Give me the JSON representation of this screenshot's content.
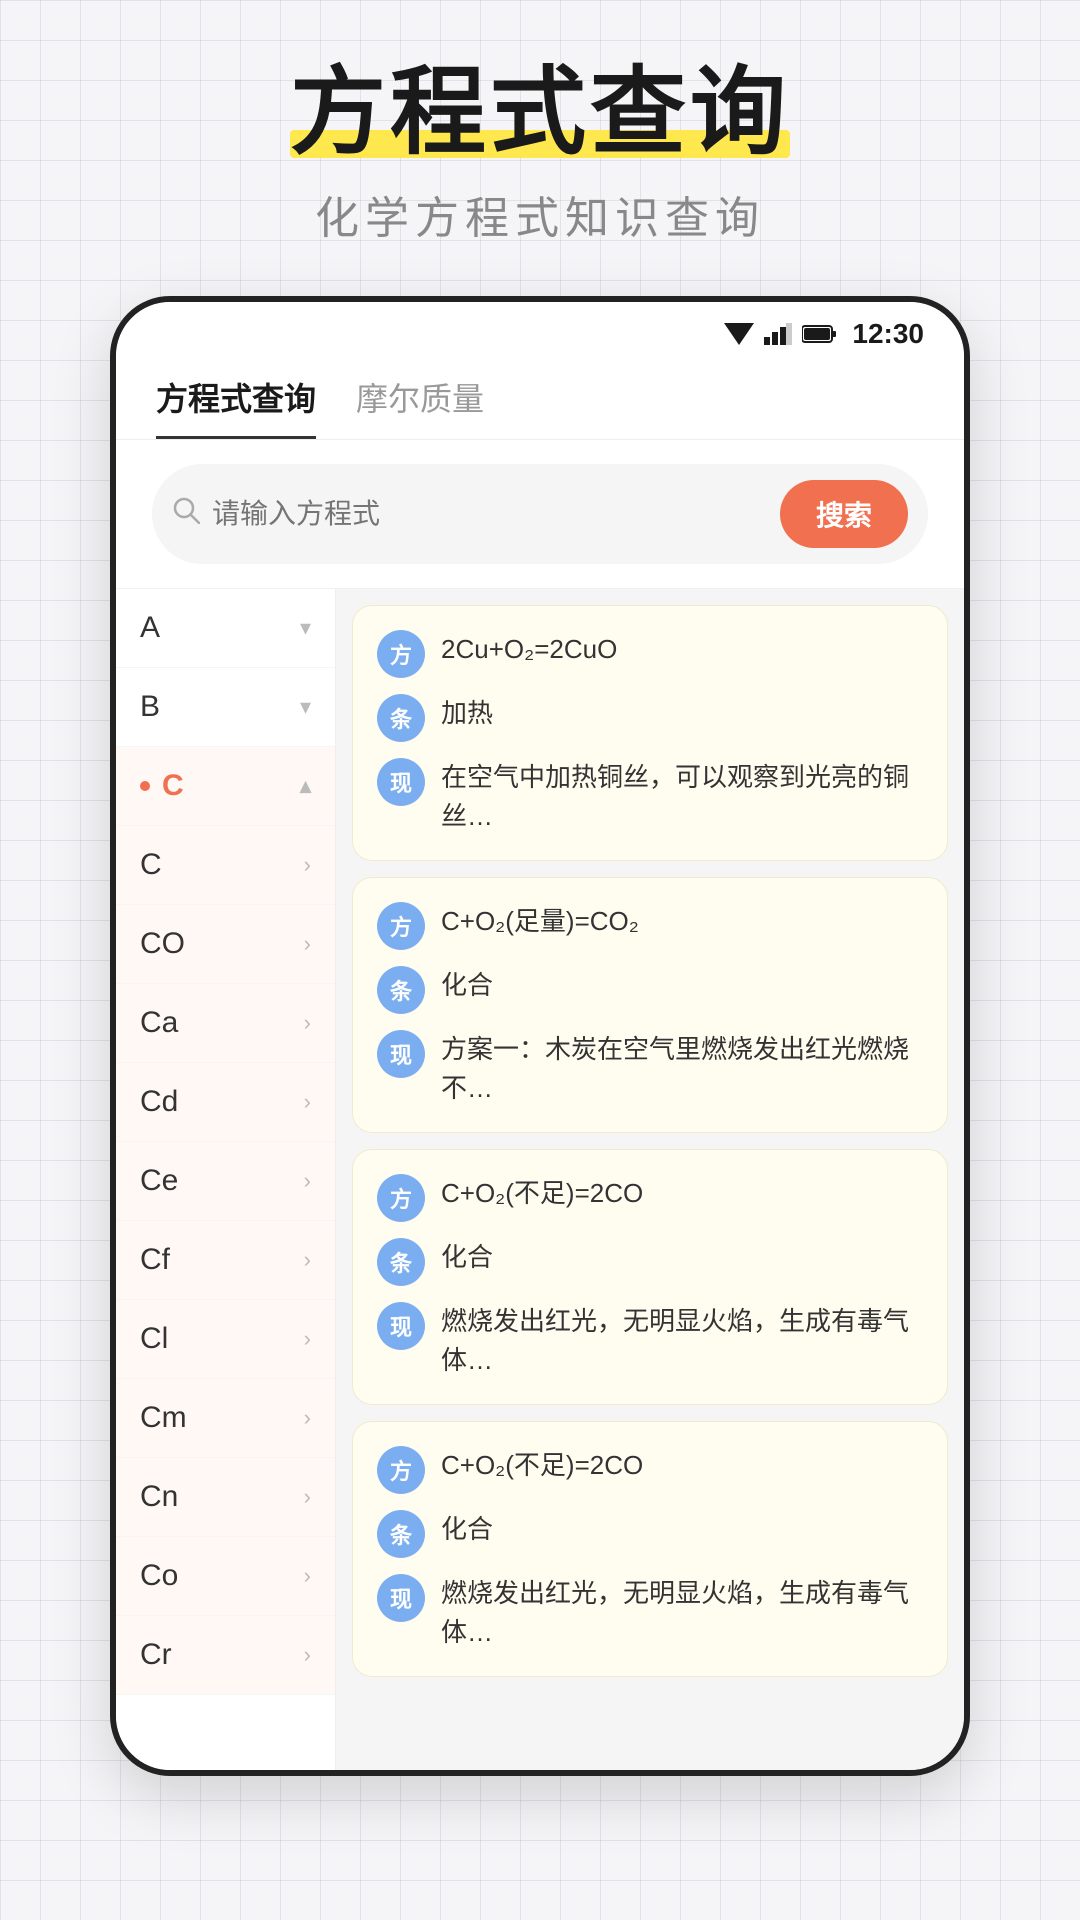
{
  "app": {
    "main_title": "方程式查询",
    "sub_title": "化学方程式知识查询",
    "status_time": "12:30"
  },
  "tabs": [
    {
      "id": "formula",
      "label": "方程式查询",
      "active": true
    },
    {
      "id": "molar",
      "label": "摩尔质量",
      "active": false
    }
  ],
  "search": {
    "placeholder": "请输入方程式",
    "button_label": "搜索"
  },
  "sidebar": {
    "items": [
      {
        "id": "A",
        "label": "A",
        "state": "collapsed"
      },
      {
        "id": "B",
        "label": "B",
        "state": "collapsed"
      },
      {
        "id": "C_header",
        "label": "C",
        "state": "expanded",
        "active": true
      },
      {
        "id": "C",
        "label": "C",
        "state": "sub"
      },
      {
        "id": "CO",
        "label": "CO",
        "state": "sub"
      },
      {
        "id": "Ca",
        "label": "Ca",
        "state": "sub"
      },
      {
        "id": "Cd",
        "label": "Cd",
        "state": "sub"
      },
      {
        "id": "Ce",
        "label": "Ce",
        "state": "sub"
      },
      {
        "id": "Cf",
        "label": "Cf",
        "state": "sub"
      },
      {
        "id": "Cl",
        "label": "Cl",
        "state": "sub"
      },
      {
        "id": "Cm",
        "label": "Cm",
        "state": "sub"
      },
      {
        "id": "Cn",
        "label": "Cn",
        "state": "sub"
      },
      {
        "id": "Co",
        "label": "Co",
        "state": "sub"
      },
      {
        "id": "Cr",
        "label": "Cr",
        "state": "sub"
      }
    ]
  },
  "cards": [
    {
      "id": "card1",
      "formula": "2Cu+O₂=2CuO",
      "condition": "加热",
      "phenomenon": "在空气中加热铜丝，可以观察到光亮的铜丝…"
    },
    {
      "id": "card2",
      "formula": "C+O₂(足量)=CO₂",
      "condition": "化合",
      "phenomenon": "方案一：木炭在空气里燃烧发出红光燃烧不…"
    },
    {
      "id": "card3",
      "formula": "C+O₂(不足)=2CO",
      "condition": "化合",
      "phenomenon": "燃烧发出红光，无明显火焰，生成有毒气体…"
    },
    {
      "id": "card4",
      "formula": "C+O₂(不足)=2CO",
      "condition": "化合",
      "phenomenon": "燃烧发出红光，无明显火焰，生成有毒气体…"
    }
  ],
  "badges": {
    "formula_label": "方",
    "condition_label": "条",
    "phenomenon_label": "现"
  }
}
